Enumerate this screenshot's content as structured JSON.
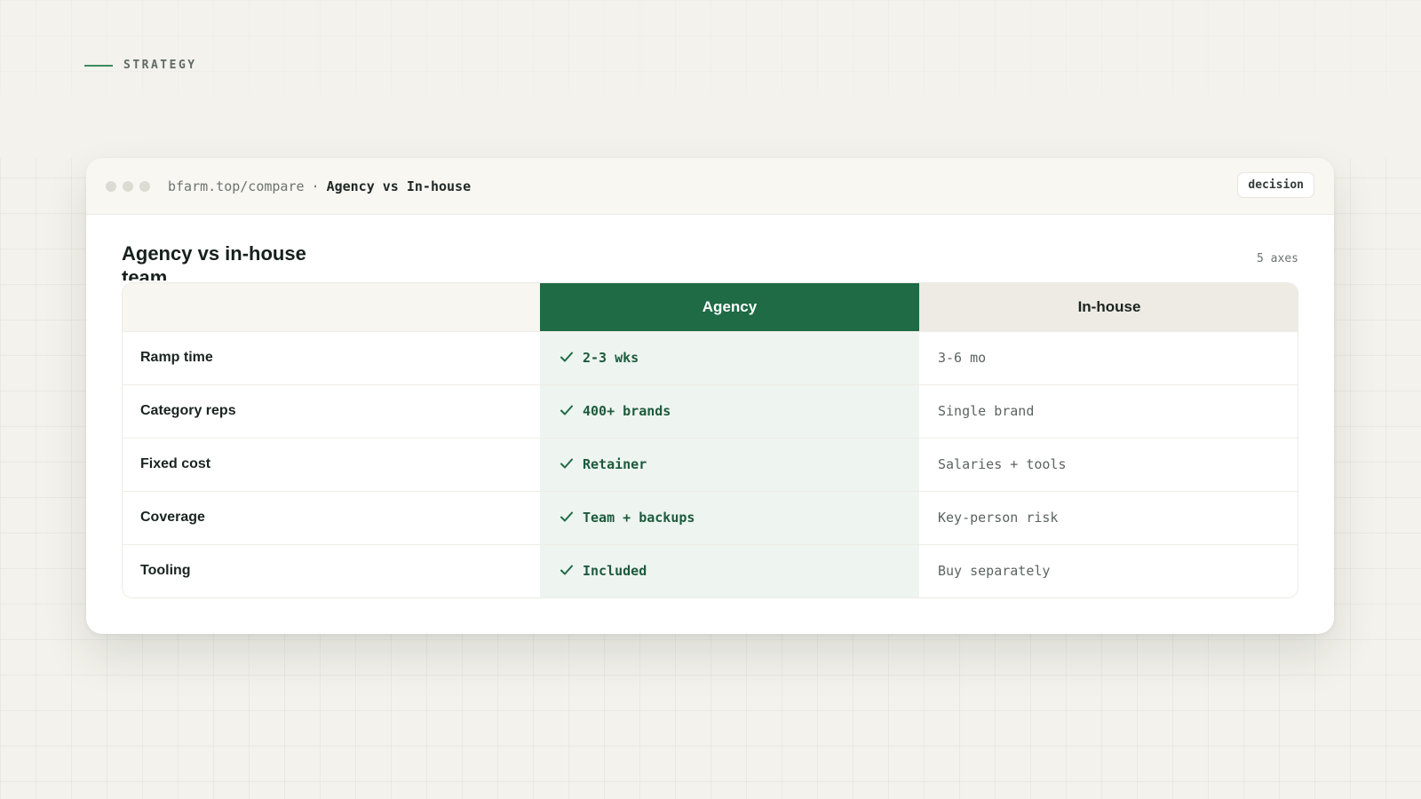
{
  "section": {
    "label": "STRATEGY"
  },
  "window": {
    "url": "bfarm.top/compare",
    "separator": "·",
    "page_title": "Agency vs In-house",
    "badge": "decision"
  },
  "card": {
    "title": "Agency vs in-house team",
    "axes_count": "5 axes"
  },
  "table": {
    "columns": [
      "",
      "Agency",
      "In-house"
    ],
    "rows": [
      {
        "label": "Ramp time",
        "agency": "2-3 wks",
        "inhouse": "3-6 mo"
      },
      {
        "label": "Category reps",
        "agency": "400+ brands",
        "inhouse": "Single brand"
      },
      {
        "label": "Fixed cost",
        "agency": "Retainer",
        "inhouse": "Salaries + tools"
      },
      {
        "label": "Coverage",
        "agency": "Team + backups",
        "inhouse": "Key-person risk"
      },
      {
        "label": "Tooling",
        "agency": "Included",
        "inhouse": "Buy separately"
      }
    ]
  },
  "colors": {
    "accent": "#1e6b45",
    "agency_tint": "#eef4f0",
    "inhouse_header": "#edebe3"
  },
  "icons": {
    "agency_marker": "check-icon"
  }
}
